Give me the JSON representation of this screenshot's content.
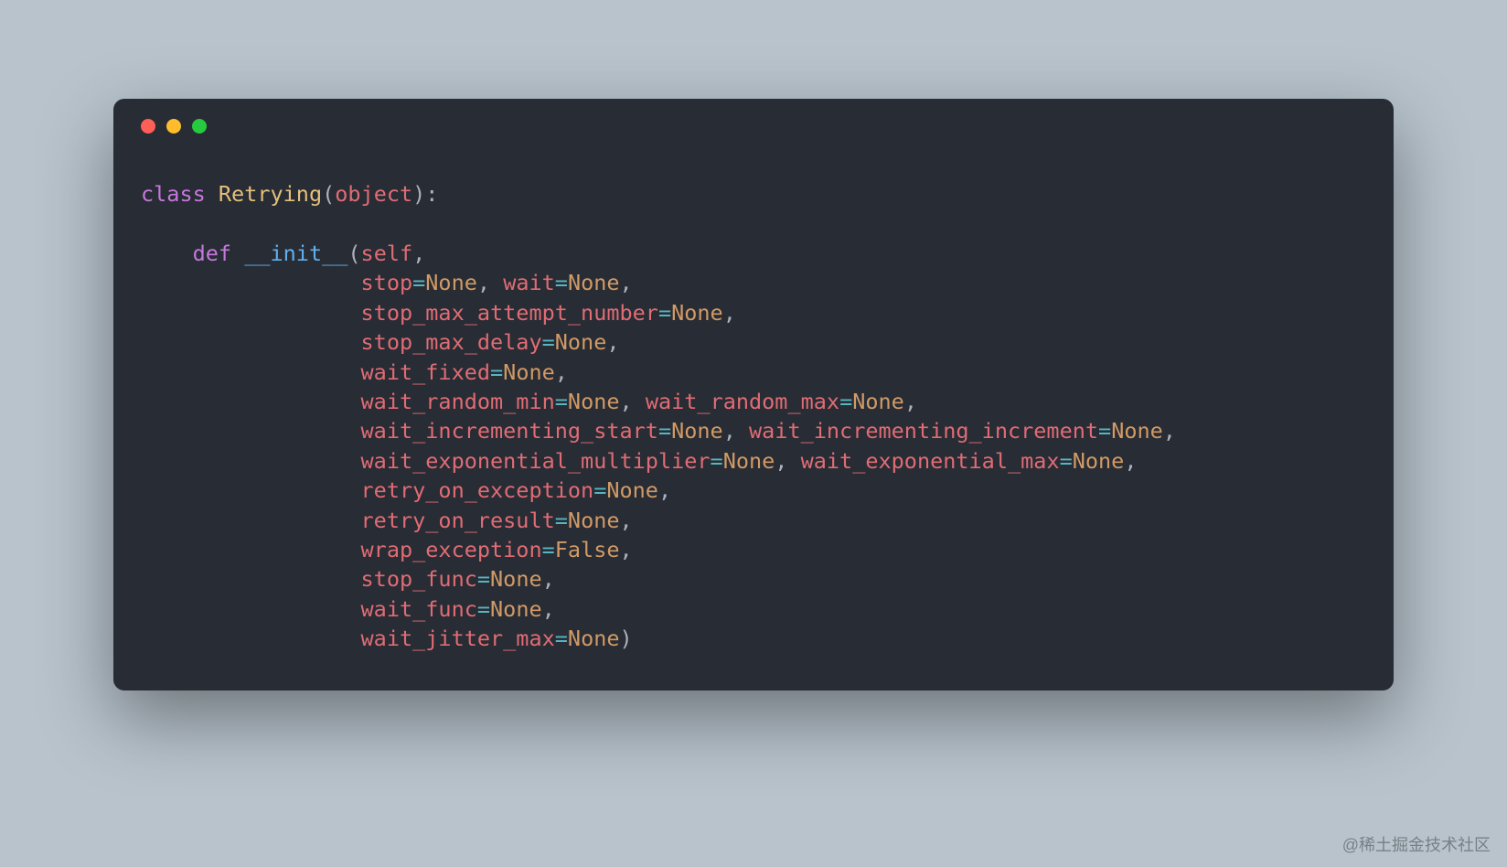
{
  "code": {
    "kw_class": "class",
    "class_name": "Retrying",
    "kw_object": "object",
    "kw_def": "def",
    "fn_init": "__init__",
    "kw_self": "self",
    "none": "None",
    "false": "False",
    "params": {
      "stop": "stop",
      "wait": "wait",
      "stop_max_attempt_number": "stop_max_attempt_number",
      "stop_max_delay": "stop_max_delay",
      "wait_fixed": "wait_fixed",
      "wait_random_min": "wait_random_min",
      "wait_random_max": "wait_random_max",
      "wait_incrementing_start": "wait_incrementing_start",
      "wait_incrementing_increment": "wait_incrementing_increment",
      "wait_exponential_multiplier": "wait_exponential_multiplier",
      "wait_exponential_max": "wait_exponential_max",
      "retry_on_exception": "retry_on_exception",
      "retry_on_result": "retry_on_result",
      "wrap_exception": "wrap_exception",
      "stop_func": "stop_func",
      "wait_func": "wait_func",
      "wait_jitter_max": "wait_jitter_max"
    }
  },
  "watermark": "@稀土掘金技术社区"
}
